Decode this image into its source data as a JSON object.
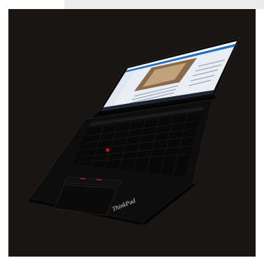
{
  "image": {
    "subject": "laptop-photo",
    "colors": {
      "background": "#191513",
      "top_bar": "#ececec",
      "chassis": "#0d0d0d",
      "trackpoint": "#d0121b",
      "screen_accent": "#1f6fc0"
    }
  },
  "laptop": {
    "logo_text": "ThinkPad"
  }
}
